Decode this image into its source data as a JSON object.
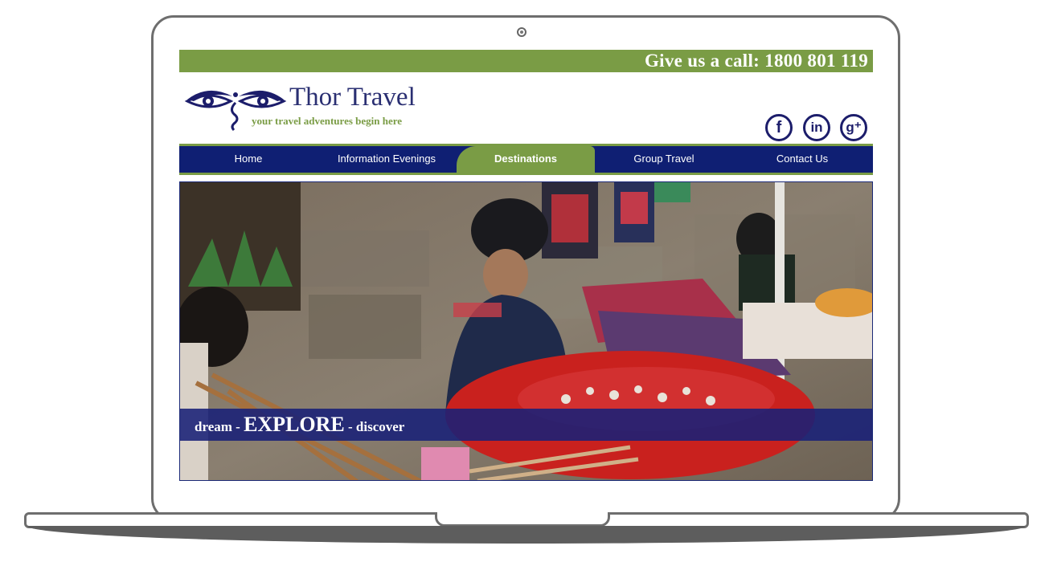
{
  "site": {
    "call_text": "Give us a call: 1800 801 119",
    "brand_name": "Thor Travel",
    "brand_tagline": "your travel adventures begin here"
  },
  "social": {
    "facebook": "f",
    "linkedin": "in",
    "googleplus": "g⁺"
  },
  "nav": {
    "items": [
      {
        "label": "Home"
      },
      {
        "label": "Information Evenings"
      },
      {
        "label": "Destinations"
      },
      {
        "label": "Group Travel"
      },
      {
        "label": "Contact Us"
      }
    ],
    "active": "Destinations"
  },
  "hero": {
    "tagline": {
      "part1": "dream - ",
      "part2": "EXPLORE",
      "part3": " - discover"
    }
  },
  "colors": {
    "accent_green": "#7a9c45",
    "nav_blue": "#0f1f73",
    "brand_blue": "#2a2f72"
  }
}
